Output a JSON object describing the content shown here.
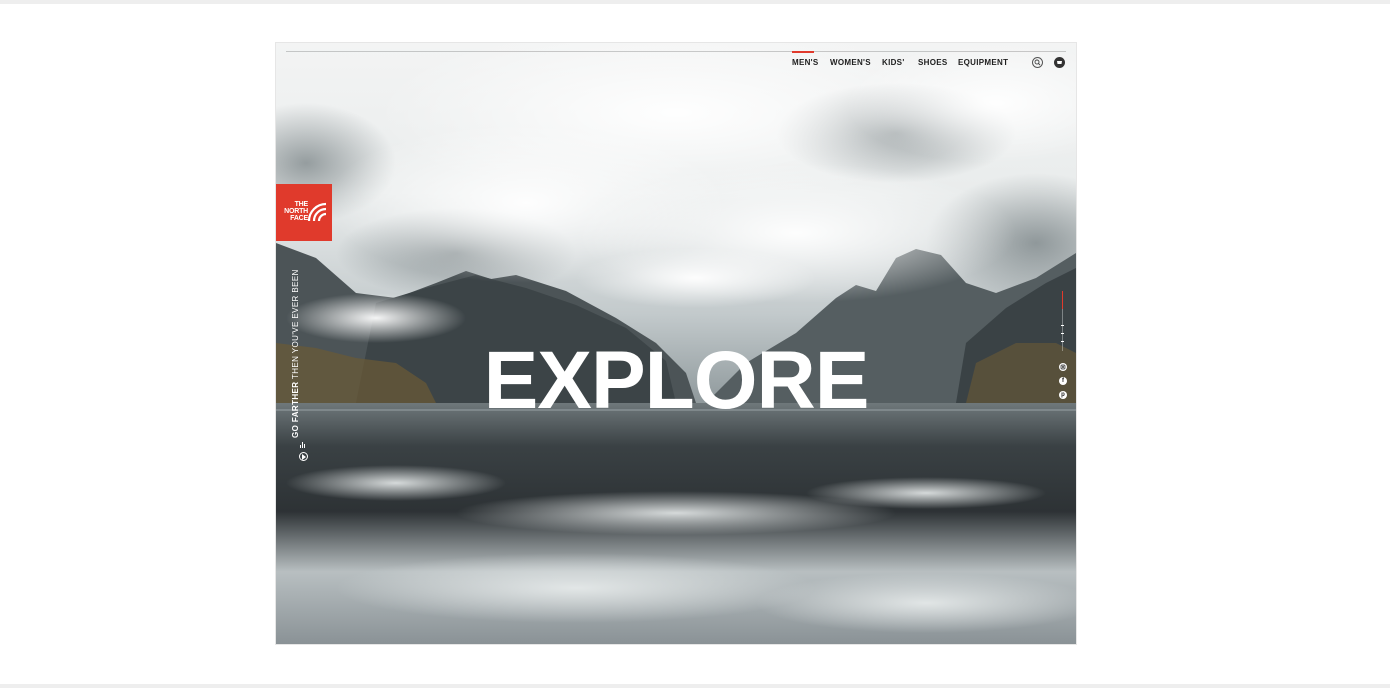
{
  "nav": {
    "items": [
      "MEN'S",
      "WOMEN'S",
      "KIDS'",
      "SHOES",
      "EQUIPMENT"
    ],
    "active_index": 0
  },
  "icons": {
    "search": "search-icon",
    "cart": "cart-icon",
    "play": "play-icon",
    "sound": "sound-bars-icon",
    "instagram": "instagram-icon",
    "facebook": "facebook-icon",
    "pinterest": "pinterest-icon"
  },
  "logo": {
    "line1": "THE",
    "line2": "NORTH",
    "line3": "FACE"
  },
  "hero": {
    "headline": "EXPLORE"
  },
  "tagline": {
    "bold": "GO FARTHER",
    "rest": " THEN YOU'VE EVER BEEN"
  },
  "colors": {
    "accent": "#e03a2c",
    "text_dark": "#1e1e1e",
    "text_light": "#ffffff"
  }
}
